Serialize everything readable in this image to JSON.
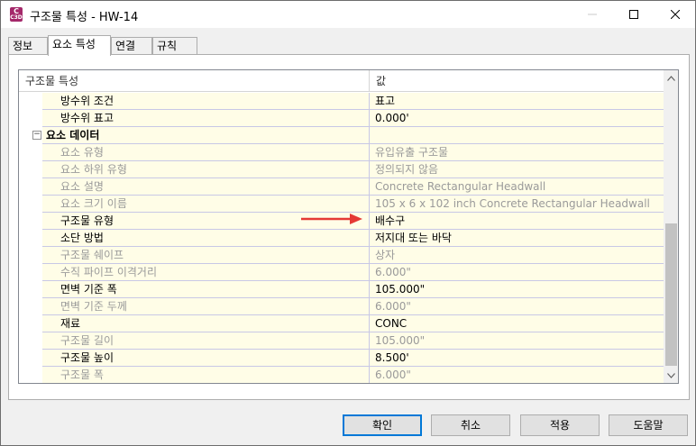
{
  "window": {
    "title": "구조물 특성 - HW-14",
    "icon": {
      "letter": "C",
      "sub": "C3D",
      "color": "#a4286a"
    }
  },
  "tabs": [
    {
      "label": "정보"
    },
    {
      "label": "요소 특성"
    },
    {
      "label": "연결"
    },
    {
      "label": "규칙"
    }
  ],
  "grid": {
    "header": {
      "property": "구조물 특성",
      "value": "값"
    },
    "rows": [
      {
        "property": "방수위 조건",
        "value": "표고",
        "disabled": false
      },
      {
        "property": "방수위 표고",
        "value": "0.000'",
        "disabled": false
      },
      {
        "category": "요소 데이터"
      },
      {
        "property": "요소 유형",
        "value": "유입유출 구조물",
        "disabled": true
      },
      {
        "property": "요소 하위 유형",
        "value": "정의되지 않음",
        "disabled": true
      },
      {
        "property": "요소 설명",
        "value": "Concrete Rectangular Headwall",
        "disabled": true
      },
      {
        "property": "요소 크기 이름",
        "value": "105 x 6 x 102 inch Concrete Rectangular Headwall",
        "disabled": true
      },
      {
        "property": "구조물 유형",
        "value": "배수구",
        "disabled": false
      },
      {
        "property": "소단 방법",
        "value": "저지대 또는 바닥",
        "disabled": false
      },
      {
        "property": "구조물 쉐이프",
        "value": "상자",
        "disabled": true
      },
      {
        "property": "수직 파이프 이격거리",
        "value": "6.000\"",
        "disabled": true
      },
      {
        "property": "면벽 기준 폭",
        "value": "105.000\"",
        "disabled": false
      },
      {
        "property": "면벽 기준 두께",
        "value": "6.000\"",
        "disabled": true
      },
      {
        "property": "재료",
        "value": "CONC",
        "disabled": false
      },
      {
        "property": "구조물 길이",
        "value": "105.000\"",
        "disabled": true
      },
      {
        "property": "구조물 높이",
        "value": "8.500'",
        "disabled": false
      },
      {
        "property": "구조물 폭",
        "value": "6.000\"",
        "disabled": true
      }
    ]
  },
  "annotation": {
    "color": "#e53935"
  },
  "buttons": {
    "ok": "확인",
    "cancel": "취소",
    "apply": "적용",
    "help": "도움말"
  }
}
